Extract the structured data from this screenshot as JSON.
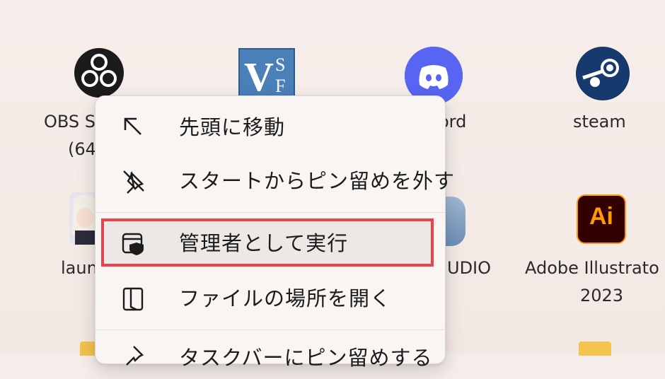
{
  "desktop": {
    "apps": [
      {
        "name": "obs",
        "label_line1": "OBS S",
        "label_line2": "(64"
      },
      {
        "name": "vsf",
        "icon_text": "VSF"
      },
      {
        "name": "discord",
        "label": "ord"
      },
      {
        "name": "steam",
        "label": "steam"
      },
      {
        "name": "launcher",
        "label": "laun"
      },
      {
        "name": "studio",
        "label": "UDIO"
      },
      {
        "name": "adobe-illustrator",
        "label_line1": "Adobe Illustrato",
        "label_line2": "2023",
        "icon_text": "Ai"
      }
    ]
  },
  "context_menu": {
    "items": [
      {
        "label": "先頭に移動",
        "icon": "move-to-top-arrow-icon"
      },
      {
        "label": "スタートからピン留めを外す",
        "icon": "unpin-icon"
      },
      {
        "label": "管理者として実行",
        "icon": "shield-window-icon",
        "selected": true
      },
      {
        "label": "ファイルの場所を開く",
        "icon": "open-file-location-icon"
      },
      {
        "label": "タスクバーにピン留めする",
        "icon": "pin-icon"
      }
    ]
  },
  "colors": {
    "highlight_border": "#f0404a",
    "menu_background": "#f8f5f3",
    "desktop_background": "#f4ebe7"
  }
}
